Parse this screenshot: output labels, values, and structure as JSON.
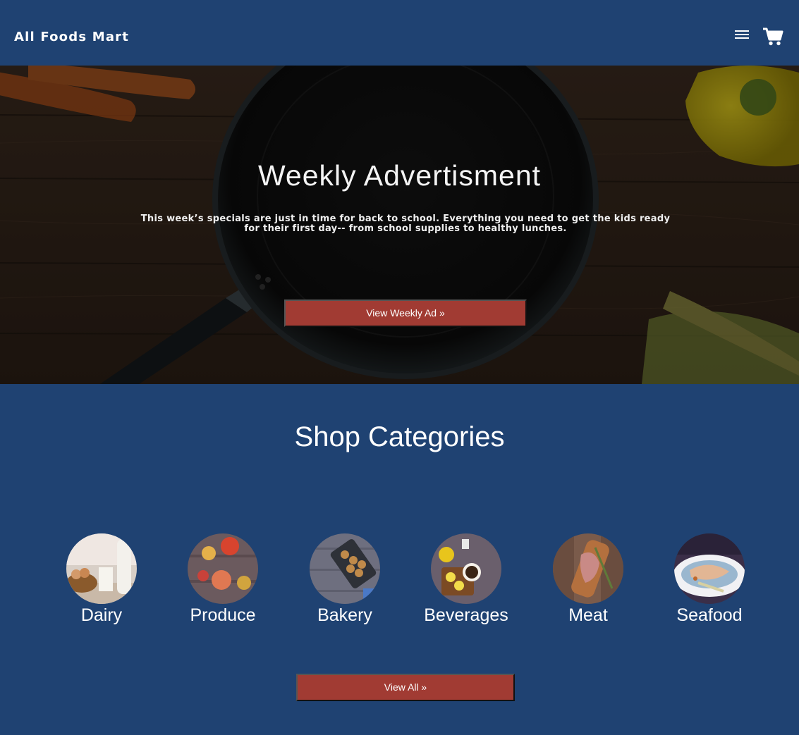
{
  "header": {
    "brand": "All Foods Mart",
    "menu_icon": "hamburger-menu-icon",
    "cart_icon": "shopping-cart-icon"
  },
  "hero": {
    "title": "Weekly Advertisment",
    "text": "This week’s specials are just in time for back to school. Everything you need to get the kids ready for their first day-- from school supplies to healthy lunches.",
    "button": "View Weekly Ad »"
  },
  "categories": {
    "title": "Shop Categories",
    "items": [
      {
        "label": "Dairy"
      },
      {
        "label": "Produce"
      },
      {
        "label": "Bakery"
      },
      {
        "label": "Beverages"
      },
      {
        "label": "Meat"
      },
      {
        "label": "Seafood"
      }
    ],
    "button": "View All »"
  },
  "colors": {
    "brand_blue": "#1f4272",
    "button_red": "#a13b33"
  }
}
